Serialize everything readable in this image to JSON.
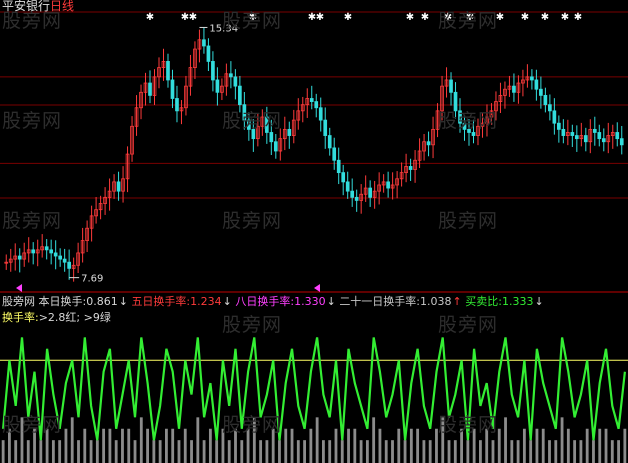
{
  "watermark": "股旁网",
  "header": {
    "stock_name": "平安银行",
    "period": "日线"
  },
  "indicator": {
    "items": [
      {
        "label": "本日换手:",
        "value": "0.861",
        "arrow": "↓"
      },
      {
        "label": "五日换手率:",
        "value": "1.234",
        "arrow": "↓"
      },
      {
        "label": "八日换手率:",
        "value": "1.330",
        "arrow": "↓"
      },
      {
        "label": "二十一日换手率:",
        "value": "1.038",
        "arrow": "↑"
      },
      {
        "label": "买卖比:",
        "value": "1.333",
        "arrow": "↓"
      }
    ]
  },
  "threshold": {
    "label": "换手率:",
    "rule": ">2.8红; >9绿"
  },
  "colors": {
    "background": "#000000",
    "up_candle": "#ff3b3b",
    "down_candle": "#33dddd",
    "grid": "#7a0000",
    "turnover_line": "#33ee33",
    "threshold_line": "#ffff66",
    "volume_bars": "#8c8c8c",
    "marker_star": "#ffffff",
    "marker_triangle": "#ff40ff"
  },
  "chart_data": [
    {
      "type": "candlestick",
      "title": "平安银行 日线",
      "annotations": [
        {
          "text": "15.34",
          "kind": "period-high"
        },
        {
          "text": "7.69",
          "kind": "period-low"
        }
      ],
      "ylim": [
        7.0,
        16.0
      ],
      "grid": true,
      "close": [
        7.9,
        8.0,
        8.1,
        8.0,
        8.2,
        8.3,
        8.2,
        8.3,
        8.4,
        8.3,
        8.2,
        8.1,
        8.0,
        7.9,
        7.7,
        7.8,
        8.2,
        8.6,
        9.0,
        9.4,
        9.6,
        9.8,
        10.0,
        10.2,
        10.5,
        10.2,
        10.6,
        11.4,
        12.3,
        12.9,
        13.4,
        13.7,
        13.3,
        13.9,
        14.2,
        14.4,
        13.8,
        13.2,
        12.8,
        12.9,
        13.6,
        14.2,
        14.8,
        15.1,
        14.9,
        14.4,
        13.8,
        13.4,
        13.6,
        14.0,
        13.9,
        13.6,
        13.0,
        12.5,
        12.2,
        11.9,
        12.3,
        12.6,
        12.1,
        11.8,
        11.5,
        11.9,
        12.2,
        12.0,
        12.5,
        12.8,
        13.0,
        13.2,
        13.1,
        12.9,
        12.5,
        12.0,
        11.6,
        11.2,
        10.8,
        10.5,
        10.2,
        10.0,
        9.9,
        10.1,
        10.3,
        10.0,
        10.2,
        10.4,
        10.5,
        10.3,
        10.4,
        10.6,
        10.8,
        11.0,
        10.9,
        11.2,
        11.5,
        11.8,
        11.7,
        12.2,
        12.8,
        13.6,
        13.8,
        13.4,
        12.8,
        12.4,
        12.2,
        12.1,
        12.0,
        12.3,
        12.4,
        12.6,
        12.8,
        13.1,
        13.3,
        13.5,
        13.6,
        13.4,
        13.7,
        13.8,
        13.9,
        13.8,
        13.5,
        13.3,
        13.0,
        12.8,
        12.4,
        12.2,
        12.0,
        12.1,
        12.0,
        11.9,
        12.0,
        11.8,
        12.2,
        12.1,
        11.9,
        11.8,
        12.0,
        12.1,
        11.9,
        11.7
      ],
      "markers": {
        "stars": 16,
        "triangles": 2
      }
    },
    {
      "type": "bar+line",
      "title": "换手率",
      "ylim": [
        0,
        12
      ],
      "reference_line": 9,
      "turnover": [
        3,
        9,
        5,
        11,
        4,
        8,
        2,
        10,
        6,
        3,
        7,
        9,
        4,
        11,
        5,
        2,
        8,
        10,
        3,
        6,
        9,
        4,
        11,
        7,
        2,
        5,
        10,
        8,
        3,
        9,
        6,
        11,
        4,
        7,
        2,
        9,
        5,
        10,
        3,
        8,
        11,
        4,
        6,
        9,
        2,
        7,
        10,
        5,
        3,
        8,
        11,
        6,
        4,
        9,
        2,
        10,
        7,
        5,
        3,
        11,
        8,
        4,
        6,
        9,
        2,
        7,
        10,
        5,
        3,
        8,
        11,
        4,
        6,
        9,
        2,
        10,
        5,
        7,
        3,
        8,
        11,
        6,
        4,
        9,
        2,
        10,
        7,
        5,
        3,
        11,
        8,
        4,
        6,
        9,
        2,
        7,
        10,
        5,
        3,
        8
      ],
      "volume": [
        2,
        3,
        2,
        4,
        2,
        3,
        2,
        3,
        2,
        2,
        3,
        4,
        2,
        3,
        2,
        2,
        3,
        3,
        2,
        3,
        3,
        2,
        4,
        3,
        2,
        2,
        3,
        3,
        2,
        3,
        2,
        4,
        2,
        3,
        2,
        3,
        2,
        3,
        2,
        3,
        4,
        2,
        2,
        3,
        2,
        3,
        3,
        2,
        2,
        3,
        4,
        2,
        2,
        3,
        2,
        3,
        3,
        2,
        2,
        4,
        3,
        2,
        2,
        3,
        2,
        3,
        3,
        2,
        2,
        3,
        4,
        2,
        2,
        3,
        2,
        3,
        2,
        3,
        2,
        3,
        4,
        2,
        2,
        3,
        2,
        3,
        3,
        2,
        2,
        4,
        3,
        2,
        2,
        3,
        2,
        3,
        3,
        2,
        2,
        3
      ]
    }
  ]
}
